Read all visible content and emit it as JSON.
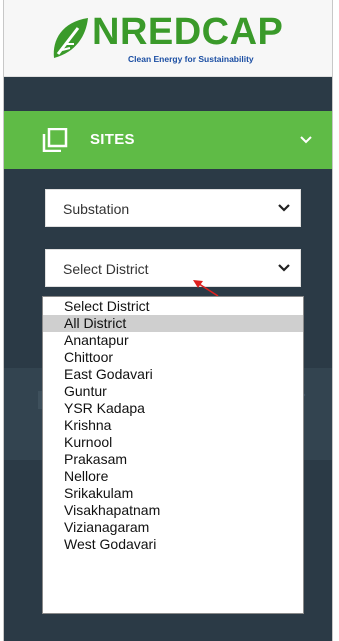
{
  "logo": {
    "name": "NREDCAP",
    "tagline": "Clean Energy for Sustainability"
  },
  "sidebar": {
    "sites_label": "SITES"
  },
  "filters": {
    "type_select": {
      "value": "Substation"
    },
    "district_select": {
      "value": "Select District"
    }
  },
  "district_dropdown": {
    "options": [
      "Select District",
      "All District",
      "Anantapur",
      "Chittoor",
      "East Godavari",
      "Guntur",
      "YSR Kadapa",
      "Krishna",
      "Kurnool",
      "Prakasam",
      "Nellore",
      "Srikakulam",
      "Visakhapatnam",
      "Vizianagaram",
      "West Godavari"
    ],
    "highlighted_option": "All District"
  },
  "colors": {
    "sidebar_bg": "#2b3a46",
    "accent_green": "#5fbb46",
    "logo_green": "#3a9a2a",
    "logo_blue": "#1b4ea3",
    "annotation_red": "#e0201e"
  },
  "icons": {
    "logo": "leaf-logo-icon",
    "sites": "pages-icon",
    "expand": "chevron-down-icon",
    "pointer": "red-arrow-annotation"
  }
}
